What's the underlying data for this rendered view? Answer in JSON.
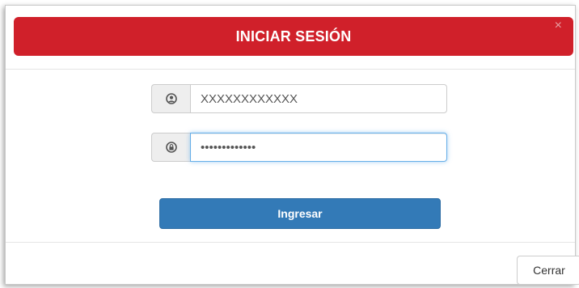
{
  "modal": {
    "title": "INICIAR SESIÓN",
    "close_symbol": "×"
  },
  "form": {
    "username": {
      "value": "XXXXXXXXXXXX",
      "icon": "user-icon"
    },
    "password": {
      "value": "•••••••••••••",
      "icon": "lock-icon"
    },
    "submit_label": "Ingresar"
  },
  "footer": {
    "close_label": "Cerrar"
  },
  "colors": {
    "header_red": "#d0202a",
    "primary_blue": "#337ab7",
    "focus_blue": "#66afe9"
  }
}
